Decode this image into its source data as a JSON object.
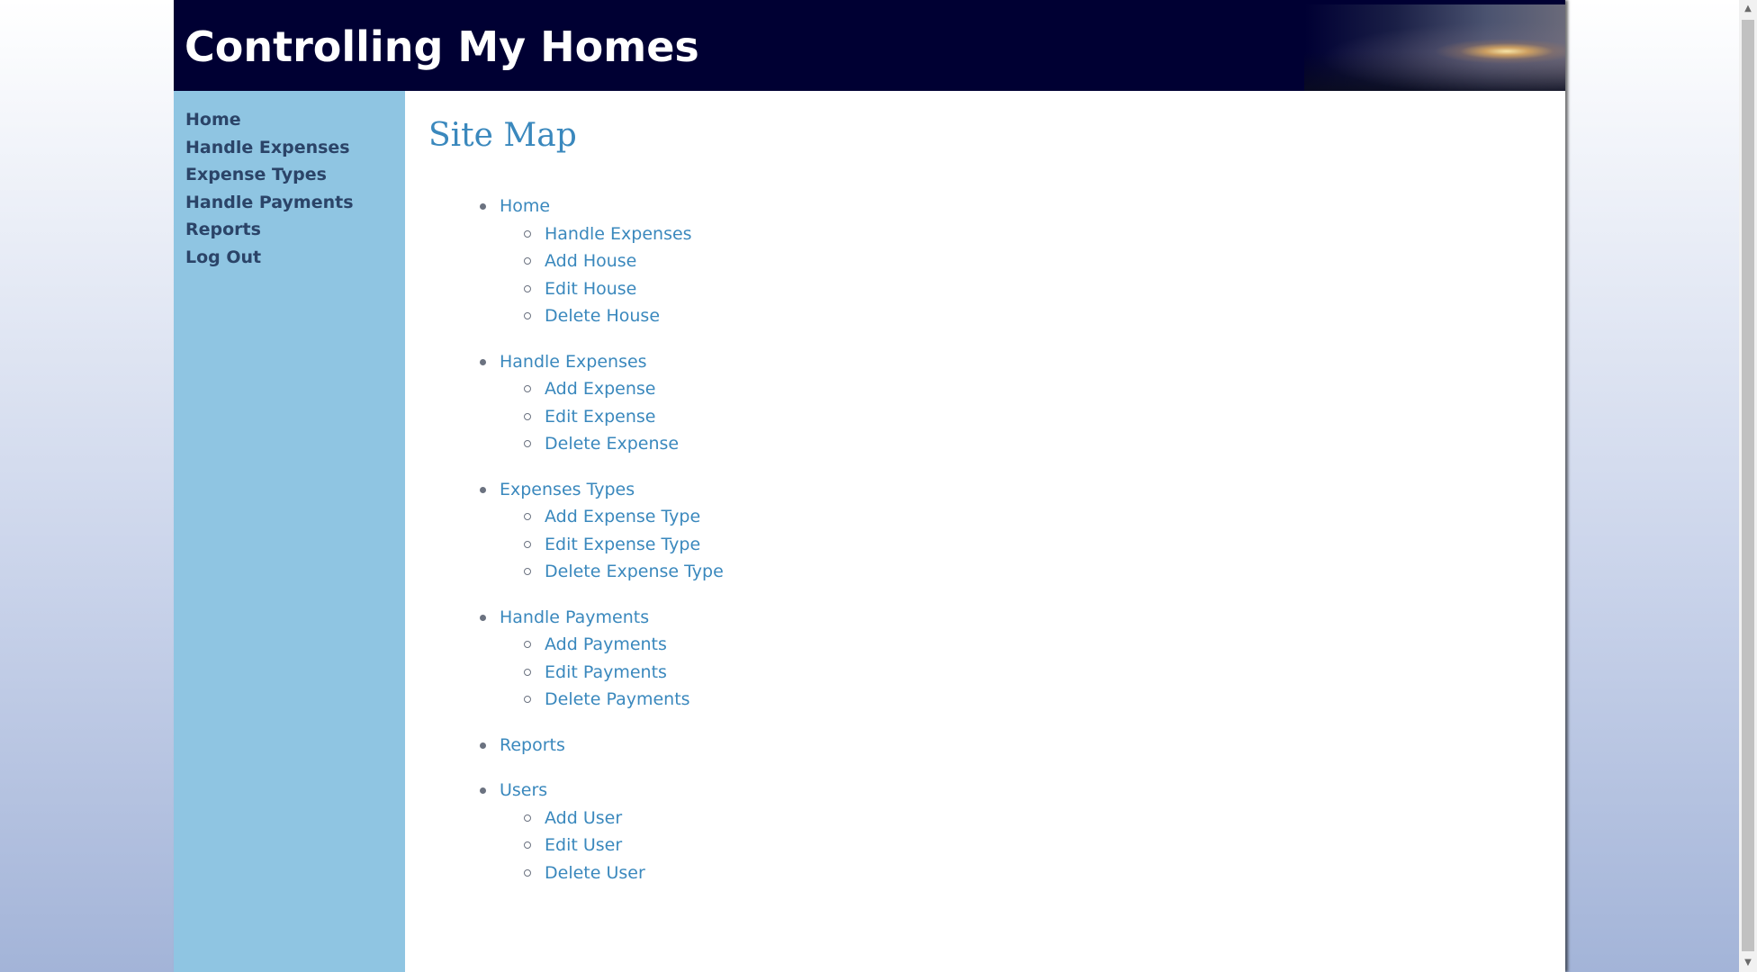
{
  "header": {
    "title": "Controlling My Homes"
  },
  "sidebar": {
    "items": [
      {
        "label": "Home"
      },
      {
        "label": "Handle Expenses"
      },
      {
        "label": "Expense Types"
      },
      {
        "label": "Handle Payments"
      },
      {
        "label": "Reports"
      },
      {
        "label": "Log Out"
      }
    ]
  },
  "main": {
    "heading": "Site Map",
    "sitemap": [
      {
        "label": "Home",
        "children": [
          {
            "label": "Handle Expenses"
          },
          {
            "label": "Add House"
          },
          {
            "label": "Edit House"
          },
          {
            "label": "Delete House"
          }
        ]
      },
      {
        "label": "Handle Expenses",
        "children": [
          {
            "label": "Add Expense"
          },
          {
            "label": "Edit Expense"
          },
          {
            "label": "Delete Expense"
          }
        ]
      },
      {
        "label": "Expenses Types",
        "children": [
          {
            "label": "Add Expense Type"
          },
          {
            "label": "Edit Expense Type"
          },
          {
            "label": "Delete Expense Type"
          }
        ]
      },
      {
        "label": "Handle Payments",
        "children": [
          {
            "label": "Add Payments"
          },
          {
            "label": "Edit Payments"
          },
          {
            "label": "Delete Payments"
          }
        ]
      },
      {
        "label": "Reports",
        "children": []
      },
      {
        "label": "Users",
        "children": [
          {
            "label": "Add User"
          },
          {
            "label": "Edit User"
          },
          {
            "label": "Delete User"
          }
        ]
      }
    ]
  },
  "scrollbar": {
    "up_icon": "chevron-up-icon",
    "down_icon": "chevron-down-icon"
  },
  "colors": {
    "header_bg": "#000033",
    "sidebar_bg": "#8fc5e2",
    "nav_text": "#2b4468",
    "link": "#3a88bd"
  }
}
